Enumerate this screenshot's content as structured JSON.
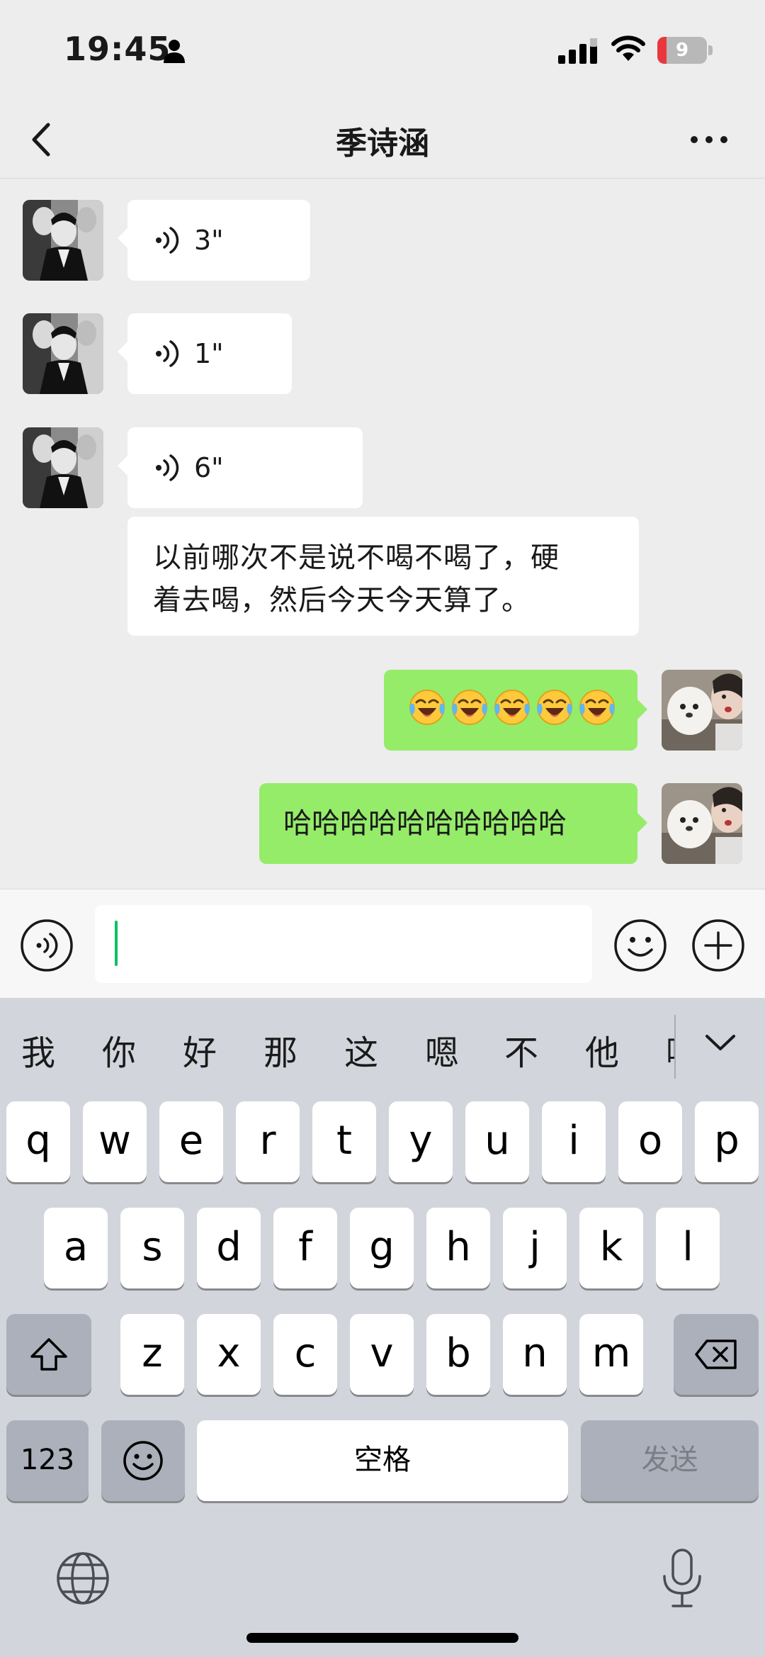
{
  "status_bar": {
    "time": "19:45",
    "battery_level": "9"
  },
  "chat": {
    "title": "季诗涵",
    "messages": [
      {
        "type": "voice",
        "direction": "incoming",
        "duration": "3\""
      },
      {
        "type": "voice",
        "direction": "incoming",
        "duration": "1\""
      },
      {
        "type": "voice",
        "direction": "incoming",
        "duration": "6\""
      },
      {
        "type": "text",
        "direction": "incoming",
        "lines": [
          "以前哪次不是说不喝不喝了，硬",
          "着去喝，然后今天今天算了。"
        ]
      },
      {
        "type": "emoji",
        "direction": "outgoing",
        "emoji": "😭",
        "count": 5
      },
      {
        "type": "text",
        "direction": "outgoing",
        "text": "哈哈哈哈哈哈哈哈哈哈"
      }
    ]
  },
  "input": {
    "value": ""
  },
  "keyboard": {
    "candidates": [
      "我",
      "你",
      "好",
      "那",
      "这",
      "嗯",
      "不",
      "他",
      "哦"
    ],
    "row1": [
      "q",
      "w",
      "e",
      "r",
      "t",
      "y",
      "u",
      "i",
      "o",
      "p"
    ],
    "row2": [
      "a",
      "s",
      "d",
      "f",
      "g",
      "h",
      "j",
      "k",
      "l"
    ],
    "row3": [
      "z",
      "x",
      "c",
      "v",
      "b",
      "n",
      "m"
    ],
    "numbers_key": "123",
    "space_key": "空格",
    "send_key": "发送"
  },
  "colors": {
    "background": "#ededed",
    "incoming_bubble": "#ffffff",
    "outgoing_bubble": "#95ec69",
    "caret": "#07c160",
    "keyboard_bg": "#d2d5db",
    "battery_low": "#e8383d"
  }
}
